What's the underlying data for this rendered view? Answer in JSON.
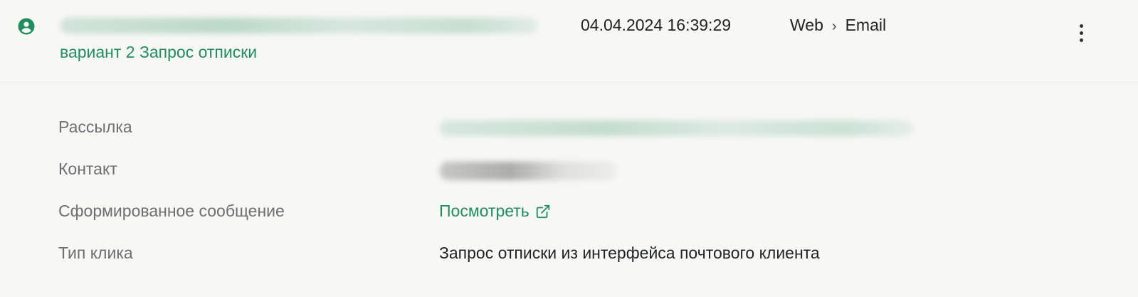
{
  "header": {
    "avatar_icon": "user-circle-icon",
    "variant_link": "вариант 2 Запрос отписки",
    "timestamp": "04.04.2024 16:39:29",
    "channel_from": "Web",
    "channel_separator": "›",
    "channel_to": "Email",
    "more_icon": "more-vertical-icon"
  },
  "details": {
    "rows": [
      {
        "label": "Рассылка"
      },
      {
        "label": "Контакт"
      },
      {
        "label": "Сформированное сообщение",
        "link_text": "Посмотреть",
        "link_icon": "external-link-icon"
      },
      {
        "label": "Тип клика",
        "value": "Запрос отписки из интерфейса почтового клиента"
      }
    ]
  },
  "colors": {
    "accent_green": "#1f8f5e",
    "background": "#f7f7f4",
    "label_grey": "#6c6f73",
    "divider": "#dfe6e6"
  }
}
